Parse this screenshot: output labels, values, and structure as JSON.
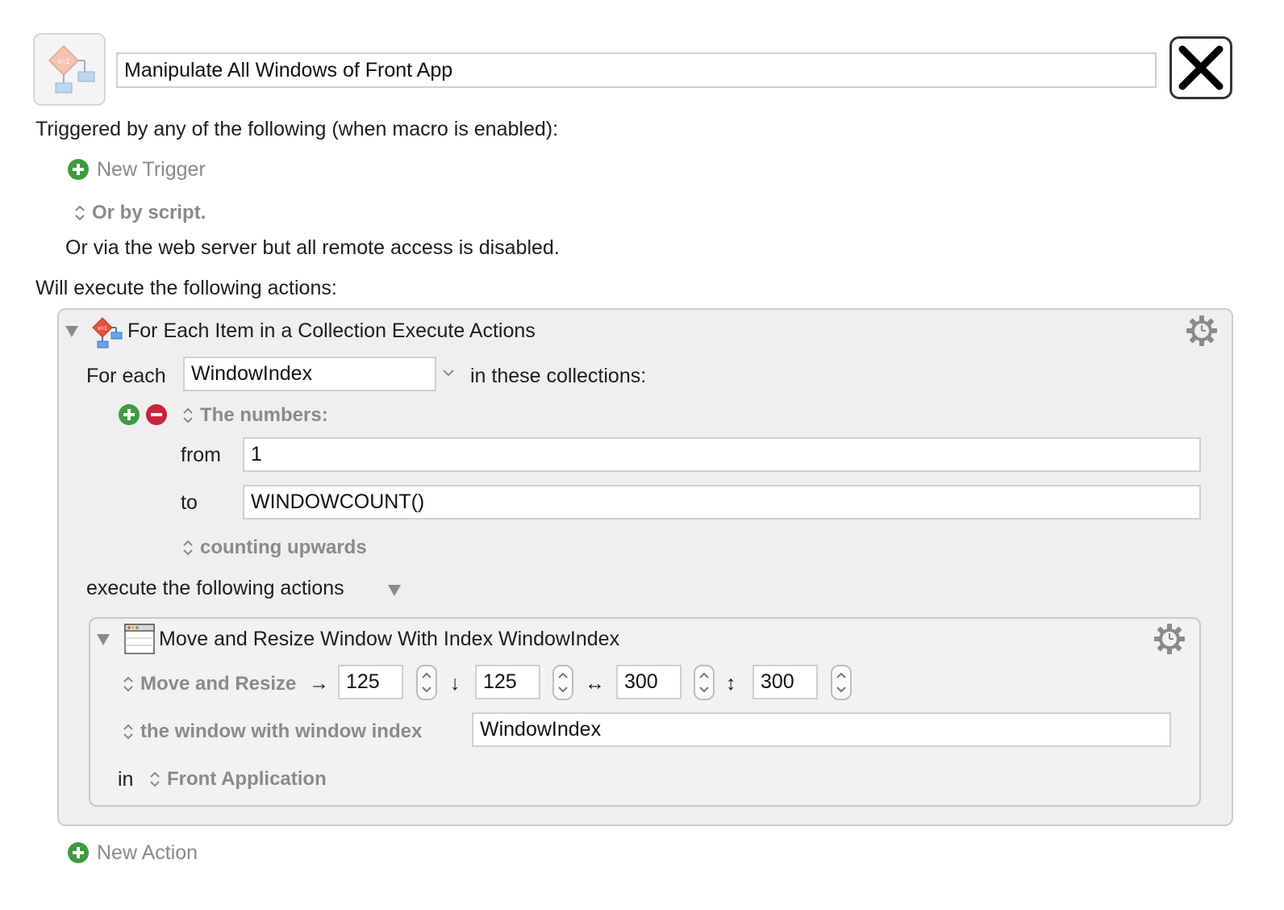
{
  "macro": {
    "name": "Manipulate All Windows of Front App",
    "close_label": "Close"
  },
  "triggers": {
    "heading": "Triggered by any of the following (when macro is enabled):",
    "new_trigger_label": "New Trigger",
    "script_label": "Or by script.",
    "web_server_text": "Or via the web server but all remote access is disabled."
  },
  "actions": {
    "heading": "Will execute the following actions:",
    "new_action_label": "New Action"
  },
  "for_each": {
    "title": "For Each Item in a Collection Execute Actions",
    "for_each_label": "For each",
    "variable_value": "WindowIndex",
    "in_collections_label": "in these collections:",
    "collection_type": "The numbers:",
    "from_label": "from",
    "from_value": "1",
    "to_label": "to",
    "to_value": "WINDOWCOUNT()",
    "direction": "counting upwards",
    "execute_label": "execute the following actions"
  },
  "move_resize": {
    "title": "Move and Resize Window With Index WindowIndex",
    "mode_label": "Move and Resize",
    "arrow_right": "→",
    "x_value": "125",
    "arrow_down": "↓",
    "y_value": "125",
    "arrow_width": "↔",
    "width_value": "300",
    "arrow_height": "↕",
    "height_value": "300",
    "window_selector_label": "the window with window index",
    "window_index_value": "WindowIndex",
    "in_label": "in",
    "app_label": "Front Application"
  },
  "colors": {
    "add_green": "#3f9b3f",
    "remove_red": "#c8243a",
    "panel_bg": "#efefef"
  },
  "icons": [
    "macro-flowchart-icon",
    "close-icon",
    "add-icon",
    "remove-icon",
    "updown-icon",
    "disclosure-triangle-icon",
    "gear-icon",
    "window-icon"
  ]
}
